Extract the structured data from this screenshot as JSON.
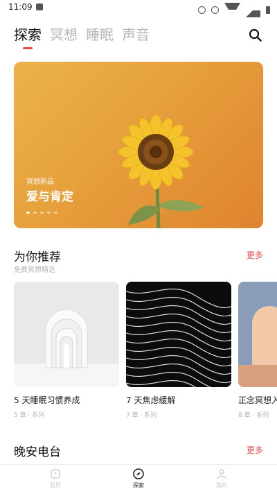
{
  "status_bar": {
    "time": "11:09"
  },
  "top_tabs": [
    {
      "label": "探索",
      "active": true
    },
    {
      "label": "冥想",
      "active": false
    },
    {
      "label": "睡眠",
      "active": false
    },
    {
      "label": "声音",
      "active": false
    }
  ],
  "accent_color": "#e84a4a",
  "banner": {
    "subtitle": "冥想新品",
    "title": "爱与肯定",
    "slide_count": 5,
    "active_slide": 1
  },
  "recommend": {
    "title": "为你推荐",
    "subtitle": "免费冥想精选",
    "more_label": "更多",
    "cards": [
      {
        "title": "5 天睡眠习惯养成",
        "meta": "5 章 · 系列"
      },
      {
        "title": "7 天焦虑缓解",
        "meta": "7 章 · 系列"
      },
      {
        "title": "正念冥想入门",
        "meta": "8 章 · 系列"
      }
    ]
  },
  "night_radio": {
    "title": "晚安电台",
    "more_label": "更多"
  },
  "bottom_nav": [
    {
      "label": "首页",
      "icon": "home-icon",
      "active": false
    },
    {
      "label": "探索",
      "icon": "compass-icon",
      "active": true
    },
    {
      "label": "我的",
      "icon": "profile-icon",
      "active": false
    }
  ]
}
